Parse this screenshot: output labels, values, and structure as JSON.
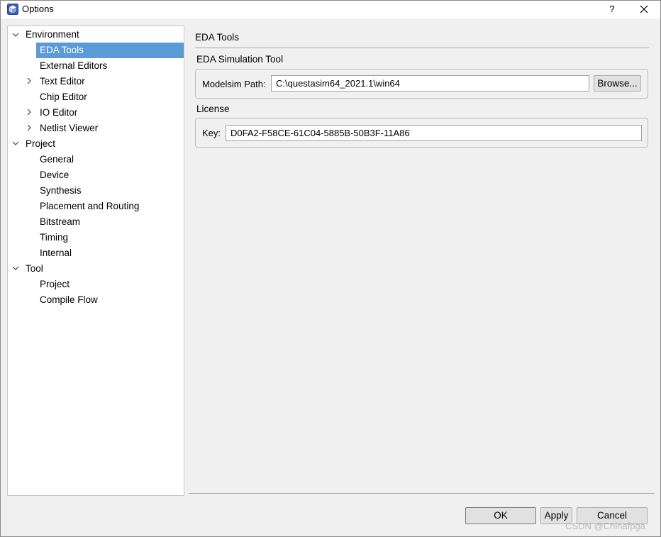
{
  "window": {
    "title": "Options",
    "help_label": "?",
    "app_icon": "cube-app-icon",
    "close_icon": "close-icon"
  },
  "tree": {
    "items": [
      {
        "label": "Environment",
        "arrow": "expanded"
      },
      {
        "label": "EDA Tools",
        "selected": true
      },
      {
        "label": "External Editors"
      },
      {
        "label": "Text Editor",
        "arrow": "collapsed"
      },
      {
        "label": "Chip Editor"
      },
      {
        "label": "IO Editor",
        "arrow": "collapsed"
      },
      {
        "label": "Netlist Viewer",
        "arrow": "collapsed"
      },
      {
        "label": "Project",
        "arrow": "expanded"
      },
      {
        "label": "General"
      },
      {
        "label": "Device"
      },
      {
        "label": "Synthesis"
      },
      {
        "label": "Placement and Routing"
      },
      {
        "label": "Bitstream"
      },
      {
        "label": "Timing"
      },
      {
        "label": "Internal"
      },
      {
        "label": "Tool",
        "arrow": "expanded"
      },
      {
        "label": "Project"
      },
      {
        "label": "Compile Flow"
      }
    ]
  },
  "content": {
    "title": "EDA Tools",
    "simulation": {
      "section_label": "EDA Simulation Tool",
      "path_label": "Modelsim Path:",
      "path_value": "C:\\questasim64_2021.1\\win64",
      "browse_label": "Browse..."
    },
    "license": {
      "section_label": "License",
      "key_label": "Key:",
      "key_value": "D0FA2-F58CE-61C04-5885B-50B3F-11A86"
    }
  },
  "buttons": {
    "ok": "OK",
    "apply": "Apply",
    "cancel": "Cancel"
  },
  "watermark": "CSDN @Chinafpga",
  "colors": {
    "selection": "#5b9bd5",
    "window_bg": "#f0f0f0"
  }
}
